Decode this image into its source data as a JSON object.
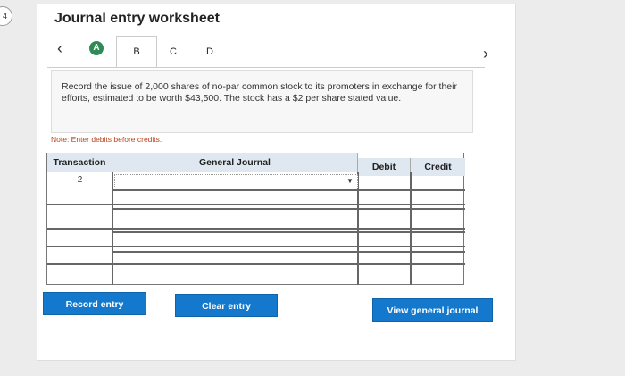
{
  "question_number": "4",
  "title": "Journal entry worksheet",
  "tabs": {
    "prev_icon": "chevron-left",
    "next_icon": "chevron-right",
    "items": [
      {
        "label": "A",
        "state": "completed"
      },
      {
        "label": "B",
        "state": "active"
      },
      {
        "label": "C",
        "state": "inactive"
      },
      {
        "label": "D",
        "state": "inactive"
      }
    ]
  },
  "prompt_text": "Record the issue of 2,000 shares of no-par common stock to its promoters in exchange for their efforts, estimated to be worth $43,500. The stock has a $2 per share stated value.",
  "note": "Note: Enter debits before credits.",
  "table": {
    "headers": {
      "transaction": "Transaction",
      "general_journal": "General Journal",
      "debit": "Debit",
      "credit": "Credit"
    },
    "rows": [
      {
        "transaction": "2",
        "account": "",
        "debit": "",
        "credit": ""
      },
      {
        "transaction": "",
        "account": "",
        "debit": "",
        "credit": ""
      },
      {
        "transaction": "",
        "account": "",
        "debit": "",
        "credit": ""
      },
      {
        "transaction": "",
        "account": "",
        "debit": "",
        "credit": ""
      },
      {
        "transaction": "",
        "account": "",
        "debit": "",
        "credit": ""
      },
      {
        "transaction": "",
        "account": "",
        "debit": "",
        "credit": ""
      }
    ]
  },
  "buttons": {
    "record": "Record entry",
    "clear": "Clear entry",
    "view": "View general journal"
  },
  "colors": {
    "accent_blue": "#1479cc",
    "completed_green": "#2e8b57",
    "note_orange": "#b8441a"
  }
}
